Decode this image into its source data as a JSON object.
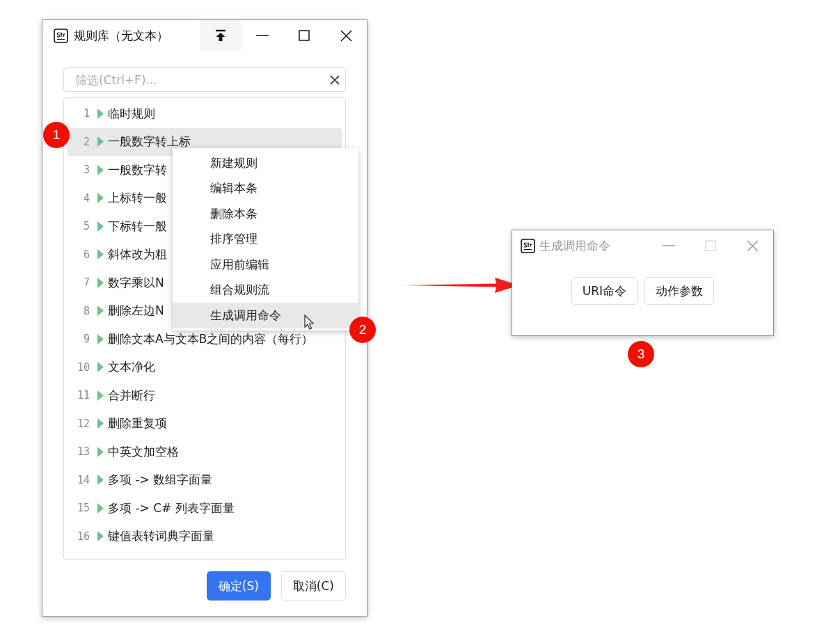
{
  "rule_window": {
    "title": "规则库（无文本）",
    "active": true,
    "filter": {
      "placeholder": "筛选(Ctrl+F)..."
    },
    "rules": [
      {
        "number": "1",
        "name": "临时规则",
        "selected": false
      },
      {
        "number": "2",
        "name": "一般数字转上标",
        "selected": true
      },
      {
        "number": "3",
        "name": "一般数字转",
        "selected": false
      },
      {
        "number": "4",
        "name": "上标转一般",
        "selected": false
      },
      {
        "number": "5",
        "name": "下标转一般",
        "selected": false
      },
      {
        "number": "6",
        "name": "斜体改为粗",
        "selected": false
      },
      {
        "number": "7",
        "name": "数字乘以N",
        "selected": false
      },
      {
        "number": "8",
        "name": "删除左边N",
        "selected": false
      },
      {
        "number": "9",
        "name": "删除文本A与文本B之间的内容（每行）",
        "selected": false
      },
      {
        "number": "10",
        "name": "文本净化",
        "selected": false
      },
      {
        "number": "11",
        "name": "合并断行",
        "selected": false
      },
      {
        "number": "12",
        "name": "删除重复项",
        "selected": false
      },
      {
        "number": "13",
        "name": "中英文加空格",
        "selected": false
      },
      {
        "number": "14",
        "name": "多项 -> 数组字面量",
        "selected": false
      },
      {
        "number": "15",
        "name": "多项 -> C# 列表字面量",
        "selected": false
      },
      {
        "number": "16",
        "name": "键值表转词典字面量",
        "selected": false
      }
    ],
    "buttons": [
      {
        "label": "确定(S)",
        "kind": "primary"
      },
      {
        "label": "取消(C)",
        "kind": "secondary"
      }
    ]
  },
  "context_menu": {
    "items": [
      {
        "label": "新建规则",
        "selected": false
      },
      {
        "label": "编辑本条",
        "selected": false
      },
      {
        "label": "删除本条",
        "selected": false
      },
      {
        "label": "排序管理",
        "selected": false
      },
      {
        "label": "应用前编辑",
        "selected": false
      },
      {
        "label": "组合规则流",
        "selected": false
      },
      {
        "label": "生成调用命令",
        "selected": true
      }
    ]
  },
  "command_window": {
    "title": "生成调用命令",
    "active": false,
    "buttons": [
      {
        "label": "URI命令"
      },
      {
        "label": "动作参数"
      }
    ]
  },
  "annotations": [
    {
      "label": "1"
    },
    {
      "label": "2"
    },
    {
      "label": "3"
    }
  ]
}
